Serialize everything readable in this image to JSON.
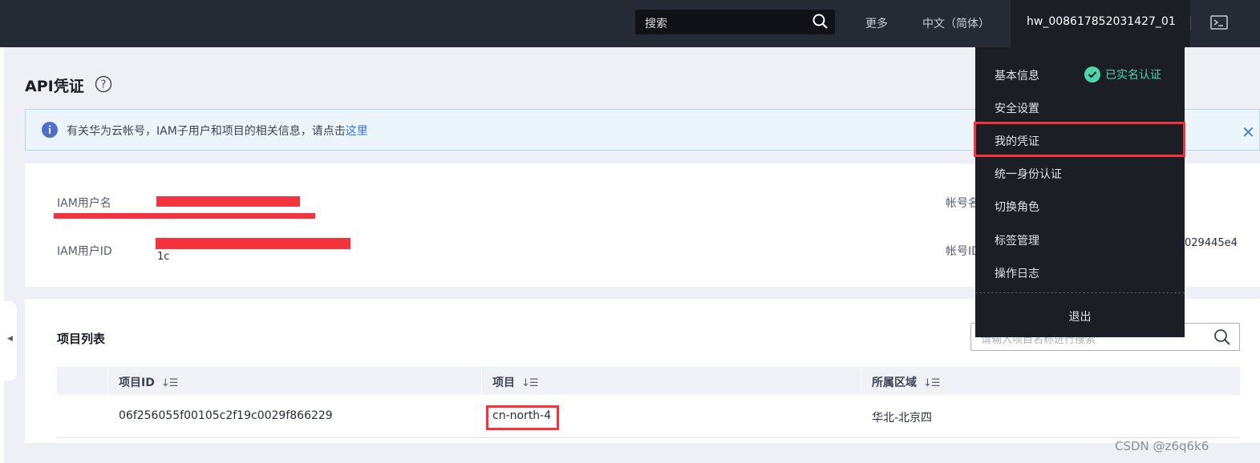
{
  "topbar": {
    "search_placeholder": "搜索",
    "more_label": "更多",
    "language_label": "中文（简体）",
    "username": "hw_008617852031427_01"
  },
  "page": {
    "title": "API凭证",
    "info_text": "有关华为云帐号，IAM子用户和项目的相关信息，请点击",
    "info_link": "这里"
  },
  "account_info": {
    "iam_username_label": "IAM用户名",
    "iam_userid_label": "IAM用户ID",
    "iam_userid_suffix": "1c",
    "account_name_label": "帐号名",
    "account_id_label": "帐号ID",
    "account_id_suffix": "029445e4"
  },
  "projects": {
    "section_title": "项目列表",
    "search_placeholder": "请输入项目名称进行搜索",
    "columns": [
      "项目ID",
      "项目",
      "所属区域"
    ],
    "sort_glyph": "↓☰",
    "rows": [
      {
        "project_id": "06f256055f00105c2f19c0029f866229",
        "project": "cn-north-4",
        "region": "华北-北京四"
      }
    ]
  },
  "user_menu": {
    "items": [
      "基本信息",
      "安全设置",
      "我的凭证",
      "统一身份认证",
      "切换角色",
      "标签管理",
      "操作日志"
    ],
    "verified_label": "已实名认证",
    "logout_label": "退出",
    "highlighted_item": "我的凭证"
  },
  "watermark": "CSDN @z6q6k6",
  "colors": {
    "topbar": "#252a35",
    "menu_bg": "#1b1e24",
    "accent_link": "#3371ff",
    "verified_green": "#50d4ab",
    "highlight_red": "#f5333f"
  }
}
